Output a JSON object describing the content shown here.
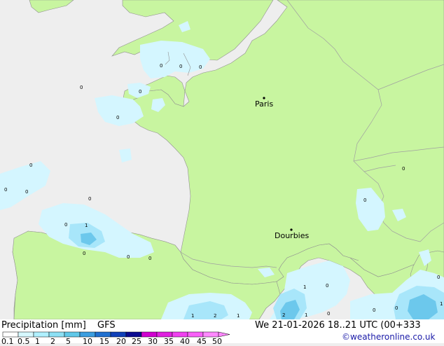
{
  "title": "Precipitation [mm]",
  "model": "GFS",
  "valid_time": "We 21-01-2026 18..21 UTC (00+333",
  "credit": "©weatheronline.co.uk",
  "cities": [
    {
      "name": "Paris"
    },
    {
      "name": "Dourbies"
    }
  ],
  "point_values": [
    "0",
    "0",
    "0",
    "0",
    "0",
    "0",
    "0",
    "0",
    "0",
    "0",
    "1",
    "0",
    "0",
    "0",
    "0",
    "0",
    "0",
    "0",
    "1",
    "0",
    "2",
    "1",
    "0",
    "1",
    "2",
    "1",
    "0",
    "1",
    "0"
  ],
  "legend": {
    "labels": [
      "0.1",
      "0.5",
      "1",
      "2",
      "5",
      "10",
      "15",
      "20",
      "25",
      "30",
      "35",
      "40",
      "45",
      "50"
    ],
    "colors": [
      "#ffffff",
      "#d6f8ff",
      "#b0f0ff",
      "#8ce0f4",
      "#60c8e8",
      "#3c9ee0",
      "#2070d0",
      "#1040b8",
      "#0a0a90",
      "#d000d0",
      "#e020e0",
      "#f040f0",
      "#f860f8",
      "#ff88ff"
    ]
  },
  "colors": {
    "land": "#c8f5a0",
    "sea": "#eeeeee",
    "precip_light": "#d4f6ff",
    "precip_mid": "#a8e6fa",
    "precip_heavy": "#6cc8ec",
    "border": "#a0a0a0",
    "coast": "#909090"
  }
}
